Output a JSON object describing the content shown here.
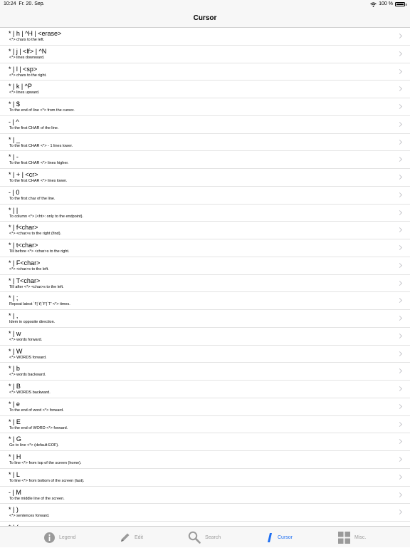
{
  "status": {
    "time": "10:24",
    "date": "Fr. 20. Sep.",
    "battery": "100 %"
  },
  "nav": {
    "title": "Cursor"
  },
  "rows": [
    {
      "title": "* | h | ^H | <erase>",
      "subtitle": "<*> chars to the left."
    },
    {
      "title": "* | j | <lf> | ^N",
      "subtitle": "<*> lines downward."
    },
    {
      "title": "* | l | <sp>",
      "subtitle": "<*> chars to the right."
    },
    {
      "title": "* | k | ^P",
      "subtitle": "<*> lines upward."
    },
    {
      "title": "* | $",
      "subtitle": "To the end of line <*> from the cursor."
    },
    {
      "title": "- | ^",
      "subtitle": "To the first CHAR of the line."
    },
    {
      "title": "* | _",
      "subtitle": "To the first CHAR <*> - 1 lines lower."
    },
    {
      "title": "* | -",
      "subtitle": "To the first CHAR <*> lines higher."
    },
    {
      "title": "* | + | <cr>",
      "subtitle": "To the first CHAR <*> lines lower."
    },
    {
      "title": "- | 0",
      "subtitle": "To the first char of the line."
    },
    {
      "title": "* | |",
      "subtitle": "To column <*> (<ht>: only to the endpoint)."
    },
    {
      "title": "* | f<char>",
      "subtitle": "<*> <char>s to the right (find)."
    },
    {
      "title": "* | t<char>",
      "subtitle": "Till before <*> <char>s to the right."
    },
    {
      "title": "* | F<char>",
      "subtitle": "<*> <char>s to the left."
    },
    {
      "title": "* | T<char>",
      "subtitle": "Till after <*> <char>s to the left."
    },
    {
      "title": "* | ;",
      "subtitle": "Repeat latest `f'|`t'|`F'|`T' <*> times."
    },
    {
      "title": "* | ,",
      "subtitle": "Idem in opposite direction."
    },
    {
      "title": "* | w",
      "subtitle": "<*> words forward."
    },
    {
      "title": "* | W",
      "subtitle": "<*> WORDS forward."
    },
    {
      "title": "* | b",
      "subtitle": "<*> words backward."
    },
    {
      "title": "* | B",
      "subtitle": "<*> WORDS backward."
    },
    {
      "title": "* | e",
      "subtitle": "To the end of word <*> forward."
    },
    {
      "title": "* | E",
      "subtitle": "To the end of WORD <*> forward."
    },
    {
      "title": "* | G",
      "subtitle": "Go to line <*> (default EOF)."
    },
    {
      "title": "* | H",
      "subtitle": "To line <*> from top of the screen (home)."
    },
    {
      "title": "* | L",
      "subtitle": "To line <*> from bottom of the screen (last)."
    },
    {
      "title": "- | M",
      "subtitle": "To the middle line of the screen."
    },
    {
      "title": "* | )",
      "subtitle": "<*> sentences forward."
    },
    {
      "title": "* | (",
      "subtitle": ""
    }
  ],
  "tabs": {
    "legend": "Legend",
    "edit": "Edit",
    "search": "Search",
    "cursor": "Cursor",
    "misc": "Misc."
  },
  "colors": {
    "accent": "#1e6ff2",
    "inactive": "#9a9a9a"
  }
}
